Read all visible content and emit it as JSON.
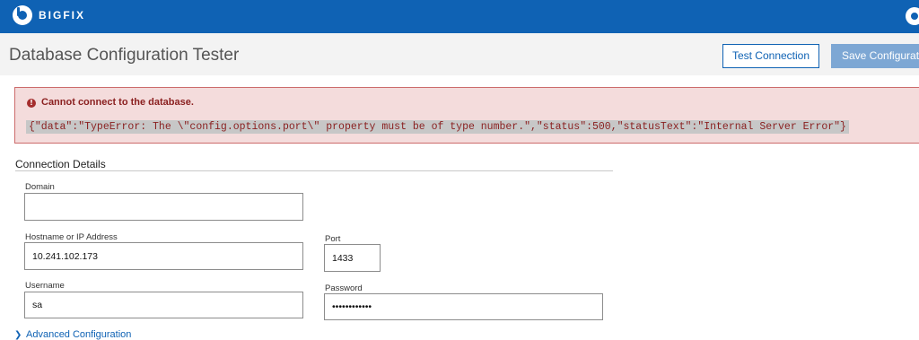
{
  "topbar": {
    "brand": "BIGFIX",
    "logo_icon": "bigfix-logo-icon",
    "right_icon": "user-menu-icon",
    "color": "#0f62b4"
  },
  "header": {
    "title": "Database Configuration Tester",
    "test_button": "Test Connection",
    "save_button": "Save Configuration"
  },
  "error": {
    "icon": "error-icon",
    "title": "Cannot connect to the database.",
    "detail": "{\"data\":\"TypeError: The \\\"config.options.port\\\" property must be of type number.\",\"status\":500,\"statusText\":\"Internal Server Error\"}"
  },
  "connection": {
    "section_title": "Connection Details",
    "domain": {
      "label": "Domain",
      "value": ""
    },
    "hostname": {
      "label": "Hostname or IP Address",
      "value": "10.241.102.173"
    },
    "port": {
      "label": "Port",
      "value": "1433"
    },
    "username": {
      "label": "Username",
      "value": "sa"
    },
    "password": {
      "label": "Password",
      "value": "••••••••••••"
    }
  },
  "advanced": {
    "label": "Advanced Configuration",
    "icon": "chevron-right-icon"
  }
}
